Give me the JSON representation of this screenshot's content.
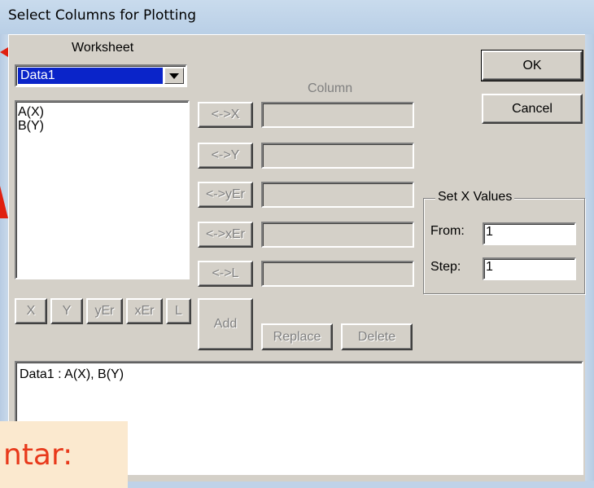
{
  "window": {
    "title": "Select Columns for Plotting"
  },
  "worksheet": {
    "label": "Worksheet",
    "selected": "Data1",
    "columns": [
      "A(X)",
      "B(Y)"
    ]
  },
  "column_area": {
    "header": "Column",
    "assign_buttons": [
      "<->X",
      "<->Y",
      "<->yEr",
      "<->xEr",
      "<->L"
    ]
  },
  "type_buttons": [
    "X",
    "Y",
    "yEr",
    "xEr",
    "L"
  ],
  "actions": {
    "add": "Add",
    "replace": "Replace",
    "delete": "Delete"
  },
  "dialog_buttons": {
    "ok": "OK",
    "cancel": "Cancel"
  },
  "set_x_values": {
    "title": "Set X Values",
    "from_label": "From:",
    "from_value": "1",
    "step_label": "Step:",
    "step_value": "1"
  },
  "plot_list": {
    "text": "Data1 : A(X), B(Y)"
  },
  "overlay": {
    "text": "ntar:"
  },
  "colors": {
    "selection": "#0a24c9",
    "dialog_bg": "#d4d0c8",
    "overlay_text": "#e8391b"
  }
}
